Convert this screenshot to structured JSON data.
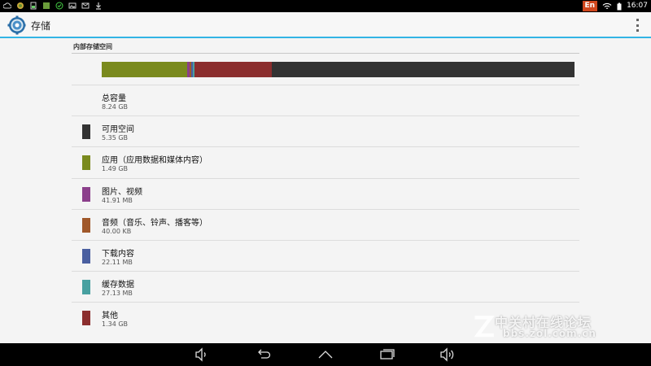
{
  "status_bar": {
    "language_badge": "En",
    "time": "16:07",
    "icons_left": [
      "cloud-icon",
      "android-icon",
      "sd-card-icon",
      "gallery-icon",
      "check-icon",
      "image-icon",
      "mail-icon",
      "download-icon"
    ],
    "icons_right": [
      "wifi-icon",
      "battery-icon"
    ]
  },
  "action_bar": {
    "title": "存储",
    "icon": "settings-gear-icon",
    "overflow_icon": "overflow-menu-icon"
  },
  "section": {
    "header": "内部存储空间"
  },
  "usage_bar": {
    "segments": [
      {
        "name": "apps",
        "fraction": 0.181,
        "color": "#7a8a1e"
      },
      {
        "name": "pictures",
        "fraction": 0.005,
        "color": "#8b3f8b"
      },
      {
        "name": "audio",
        "fraction": 0.004,
        "color": "#a0582a"
      },
      {
        "name": "downloads",
        "fraction": 0.003,
        "color": "#4a5fa0"
      },
      {
        "name": "cache",
        "fraction": 0.004,
        "color": "#47a0a0"
      },
      {
        "name": "misc",
        "fraction": 0.162,
        "color": "#8b2e2e"
      },
      {
        "name": "available",
        "fraction": 0.641,
        "color": "#333333"
      }
    ]
  },
  "items": [
    {
      "title": "总容量",
      "value": "8.24 GB",
      "color": ""
    },
    {
      "title": "可用空间",
      "value": "5.35 GB",
      "color": "#333333"
    },
    {
      "title": "应用（应用数据和媒体内容）",
      "value": "1.49 GB",
      "color": "#7a8a1e"
    },
    {
      "title": "图片、视频",
      "value": "41.91 MB",
      "color": "#8b3f8b"
    },
    {
      "title": "音频（音乐、铃声、播客等）",
      "value": "40.00 KB",
      "color": "#a0582a"
    },
    {
      "title": "下载内容",
      "value": "22.11 MB",
      "color": "#4a5fa0"
    },
    {
      "title": "缓存数据",
      "value": "27.13 MB",
      "color": "#47a0a0"
    },
    {
      "title": "其他",
      "value": "1.34 GB",
      "color": "#8b2e2e"
    }
  ],
  "nav_bar": {
    "buttons": [
      "volume-down-icon",
      "back-icon",
      "home-icon",
      "recents-icon",
      "volume-up-icon"
    ]
  },
  "watermark": {
    "line1": "中关村在线论坛",
    "line2": "bbs.zol.com.cn"
  }
}
